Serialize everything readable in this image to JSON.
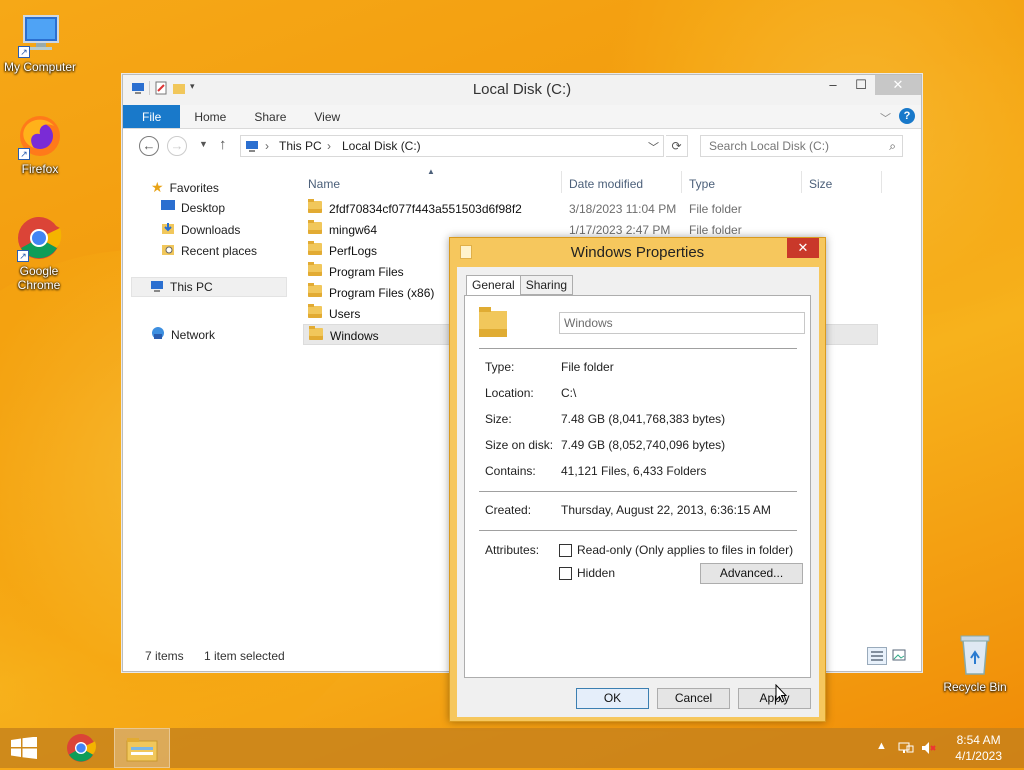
{
  "desktop": {
    "icons": [
      {
        "label": "My Computer",
        "icon": "computer-icon"
      },
      {
        "label": "Firefox",
        "icon": "firefox-icon"
      },
      {
        "label": "Google Chrome",
        "icon": "chrome-icon"
      },
      {
        "label": "Recycle Bin",
        "icon": "recycle-bin-icon"
      }
    ]
  },
  "explorer": {
    "title": "Local Disk (C:)",
    "ribbon_tabs": [
      "File",
      "Home",
      "Share",
      "View"
    ],
    "breadcrumb": [
      "This PC",
      "Local Disk (C:)"
    ],
    "search_placeholder": "Search Local Disk (C:)",
    "nav": {
      "favorites": "Favorites",
      "desktop": "Desktop",
      "downloads": "Downloads",
      "recent": "Recent places",
      "this_pc": "This PC",
      "network": "Network"
    },
    "columns": [
      "Name",
      "Date modified",
      "Type",
      "Size"
    ],
    "files": [
      {
        "name": "2fdf70834cf077f443a551503d6f98f2",
        "date": "3/18/2023 11:04 PM",
        "type": "File folder"
      },
      {
        "name": "mingw64",
        "date": "1/17/2023 2:47 PM",
        "type": "File folder"
      },
      {
        "name": "PerfLogs",
        "date": "",
        "type": ""
      },
      {
        "name": "Program Files",
        "date": "",
        "type": ""
      },
      {
        "name": "Program Files (x86)",
        "date": "",
        "type": ""
      },
      {
        "name": "Users",
        "date": "",
        "type": ""
      },
      {
        "name": "Windows",
        "date": "",
        "type": ""
      }
    ],
    "status_items": "7 items",
    "status_selected": "1 item selected"
  },
  "properties": {
    "title": "Windows Properties",
    "tabs": [
      "General",
      "Sharing"
    ],
    "name_value": "Windows",
    "type_label": "Type:",
    "type_value": "File folder",
    "location_label": "Location:",
    "location_value": "C:\\",
    "size_label": "Size:",
    "size_value": "7.48 GB (8,041,768,383 bytes)",
    "size_on_disk_label": "Size on disk:",
    "size_on_disk_value": "7.49 GB (8,052,740,096 bytes)",
    "contains_label": "Contains:",
    "contains_value": "41,121 Files, 6,433 Folders",
    "created_label": "Created:",
    "created_value": "Thursday, August 22, 2013, 6:36:15 AM",
    "attributes_label": "Attributes:",
    "readonly_label": "Read-only (Only applies to files in folder)",
    "hidden_label": "Hidden",
    "advanced_label": "Advanced...",
    "ok_label": "OK",
    "cancel_label": "Cancel",
    "apply_label": "Apply"
  },
  "taskbar": {
    "time": "8:54 AM",
    "date": "4/1/2023"
  }
}
